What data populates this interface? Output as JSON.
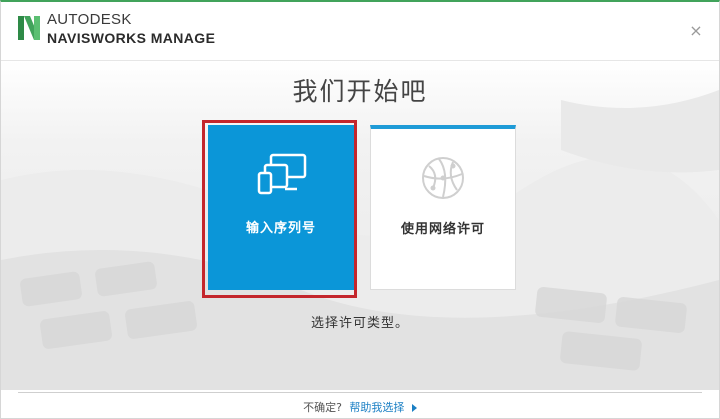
{
  "header": {
    "brand_top": "AUTODESK",
    "brand_bottom": "NAVISWORKS MANAGE",
    "logo_icon": "navisworks-n-logo",
    "close_icon": "close-icon",
    "close_glyph": "×"
  },
  "main": {
    "title": "我们开始吧",
    "subtitle": "选择许可类型。",
    "options": [
      {
        "label": "输入序列号",
        "icon": "devices-icon",
        "selected": true
      },
      {
        "label": "使用网络许可",
        "icon": "network-globe-icon",
        "selected": false
      }
    ]
  },
  "footer": {
    "question": "不确定?",
    "link_label": "帮助我选择"
  },
  "colors": {
    "accent_green": "#41a35b",
    "card_blue": "#0b96d8",
    "card_top_border": "#1e9bd7",
    "highlight_red": "#c4262c",
    "link_blue": "#1a7fc4"
  }
}
